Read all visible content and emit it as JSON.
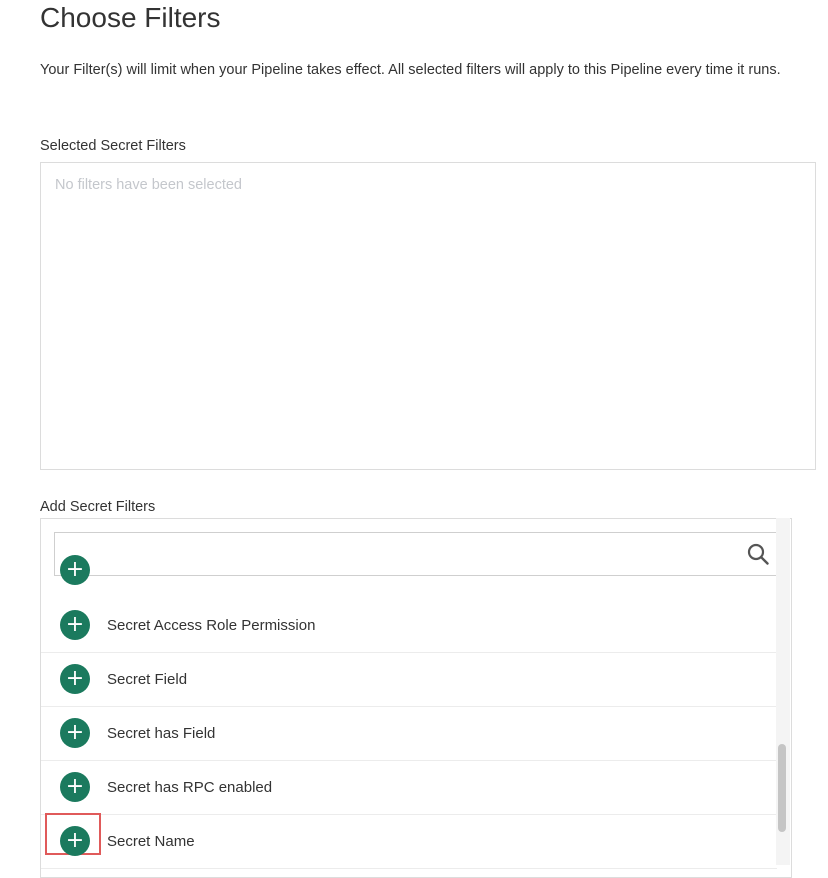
{
  "page": {
    "title": "Choose Filters",
    "description": "Your Filter(s) will limit when your Pipeline takes effect. All selected filters will apply to this Pipeline every time it runs."
  },
  "selected": {
    "label": "Selected Secret Filters",
    "empty_text": "No filters have been selected"
  },
  "add": {
    "label": "Add Secret Filters",
    "search": {
      "value": "",
      "placeholder": ""
    },
    "items": [
      {
        "label": ""
      },
      {
        "label": "Secret Access Role Permission"
      },
      {
        "label": "Secret Field"
      },
      {
        "label": "Secret has Field"
      },
      {
        "label": "Secret has RPC enabled"
      },
      {
        "label": "Secret Name"
      }
    ]
  },
  "icons": {
    "search": "search-icon",
    "add": "plus-circle-icon"
  },
  "colors": {
    "accent": "#1b7a5e",
    "highlight": "#e05a5a",
    "placeholder_text": "#c4c7cc"
  }
}
